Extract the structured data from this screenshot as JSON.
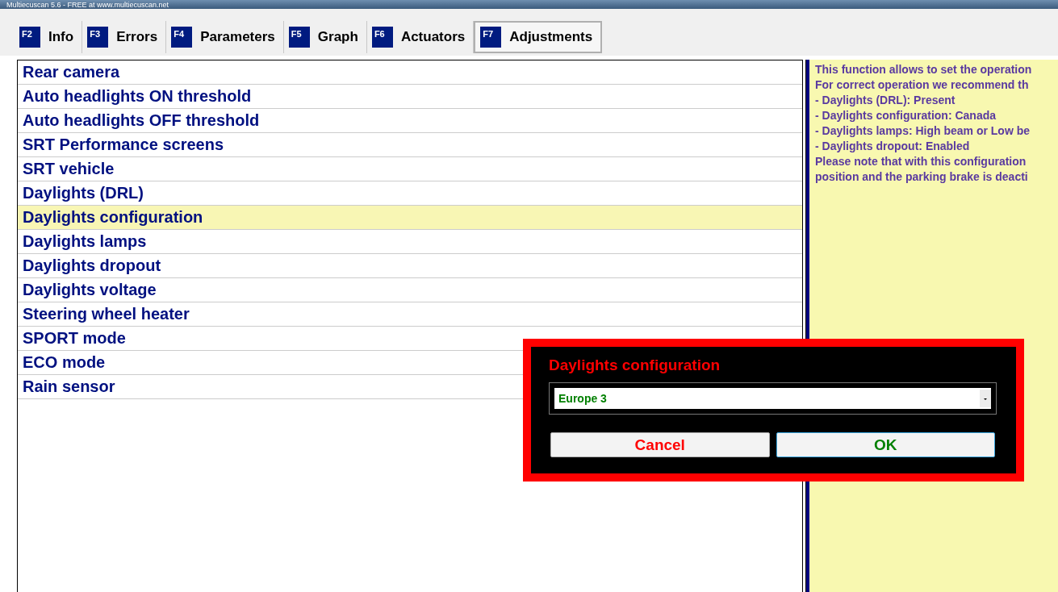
{
  "window": {
    "title": "Multiecuscan 5.6 - FREE at www.multiecuscan.net"
  },
  "tabs": [
    {
      "key": "F2",
      "label": "Info",
      "selected": false
    },
    {
      "key": "F3",
      "label": "Errors",
      "selected": false
    },
    {
      "key": "F4",
      "label": "Parameters",
      "selected": false
    },
    {
      "key": "F5",
      "label": "Graph",
      "selected": false
    },
    {
      "key": "F6",
      "label": "Actuators",
      "selected": false
    },
    {
      "key": "F7",
      "label": "Adjustments",
      "selected": true
    }
  ],
  "adjustments": [
    {
      "label": "Rear camera",
      "selected": false
    },
    {
      "label": "Auto headlights ON threshold",
      "selected": false
    },
    {
      "label": "Auto headlights OFF threshold",
      "selected": false
    },
    {
      "label": "SRT Performance screens",
      "selected": false
    },
    {
      "label": "SRT vehicle",
      "selected": false
    },
    {
      "label": "Daylights (DRL)",
      "selected": false
    },
    {
      "label": "Daylights configuration",
      "selected": true
    },
    {
      "label": "Daylights lamps",
      "selected": false
    },
    {
      "label": "Daylights dropout",
      "selected": false
    },
    {
      "label": "Daylights voltage",
      "selected": false
    },
    {
      "label": "Steering wheel heater",
      "selected": false
    },
    {
      "label": "SPORT mode",
      "selected": false
    },
    {
      "label": "ECO mode",
      "selected": false
    },
    {
      "label": "Rain sensor",
      "selected": false
    }
  ],
  "description": [
    "This function allows to set the operation",
    "For correct operation we recommend th",
    "- Daylights (DRL): Present",
    "- Daylights configuration: Canada",
    "- Daylights lamps: High beam or Low be",
    "- Daylights dropout: Enabled",
    "Please note that with this configuration",
    "position and the parking brake is deacti"
  ],
  "dialog": {
    "title": "Daylights configuration",
    "value": "Europe 3",
    "buttons": [
      "Cancel",
      "OK"
    ]
  }
}
